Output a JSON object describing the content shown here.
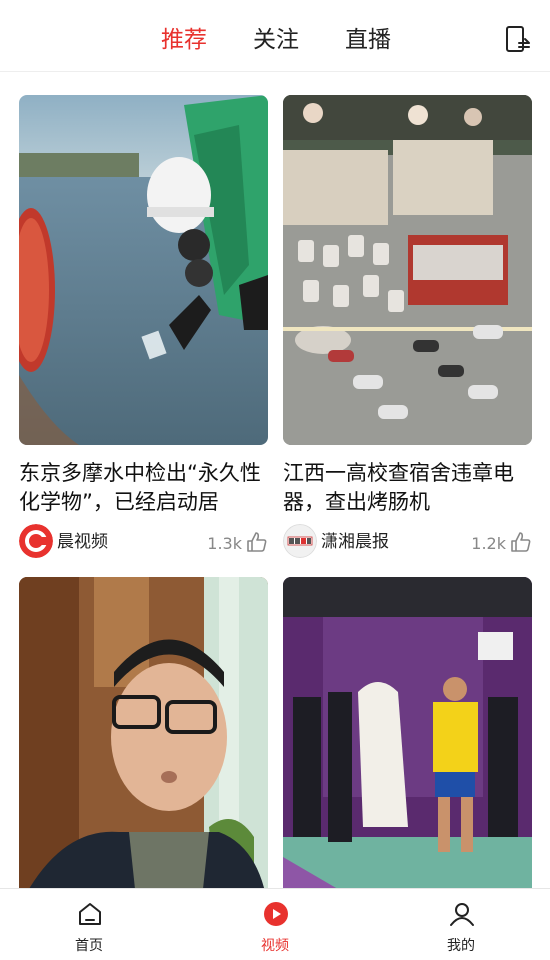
{
  "top_tabs": [
    {
      "label": "推荐",
      "active": true
    },
    {
      "label": "关注",
      "active": false
    },
    {
      "label": "直播",
      "active": false
    }
  ],
  "feed": [
    {
      "title": "东京多摩水中检出“永久性化学物”，已经启动居",
      "source": "晨视频",
      "likes": "1.3k",
      "source_logo_color": "#e8322e"
    },
    {
      "title": "江西一高校查宿舍违章电器，查出烤肠机",
      "source": "潇湘晨报",
      "likes": "1.2k",
      "source_logo_text": "潇湘晨报"
    },
    {
      "title": "",
      "source": "",
      "likes": ""
    },
    {
      "title": "",
      "source": "",
      "likes": ""
    }
  ],
  "bottom_nav": [
    {
      "label": "首页",
      "icon": "home-icon",
      "active": false
    },
    {
      "label": "视频",
      "icon": "video-play-icon",
      "active": true
    },
    {
      "label": "我的",
      "icon": "profile-icon",
      "active": false
    }
  ],
  "colors": {
    "accent": "#e8322e",
    "text": "#111111",
    "muted": "#888888"
  }
}
